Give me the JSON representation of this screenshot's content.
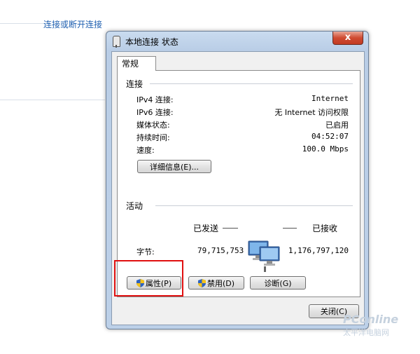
{
  "background": {
    "link_text": "连接或断开连接"
  },
  "window": {
    "title": "本地连接 状态",
    "close_label": "x",
    "tab_label": "常规"
  },
  "connection": {
    "section_title": "连接",
    "rows": [
      {
        "label": "IPv4 连接:",
        "value": "Internet"
      },
      {
        "label": "IPv6 连接:",
        "value": "无 Internet 访问权限"
      },
      {
        "label": "媒体状态:",
        "value": "已启用"
      },
      {
        "label": "持续时间:",
        "value": "04:52:07"
      },
      {
        "label": "速度:",
        "value": "100.0 Mbps"
      }
    ],
    "details_button": "详细信息(E)..."
  },
  "activity": {
    "section_title": "活动",
    "sent_label": "已发送",
    "received_label": "已接收",
    "bytes_label": "字节:",
    "bytes_sent": "79,715,753",
    "bytes_received": "1,176,797,120"
  },
  "buttons": {
    "properties": "属性(P)",
    "disable": "禁用(D)",
    "diagnose": "诊断(G)",
    "close": "关闭(C)"
  },
  "watermark": {
    "logo": "PConline",
    "sub": "太平洋电脑网"
  },
  "colors": {
    "highlight": "#e01010",
    "link": "#1e5fb0",
    "titlebar": "#c9dbef"
  }
}
